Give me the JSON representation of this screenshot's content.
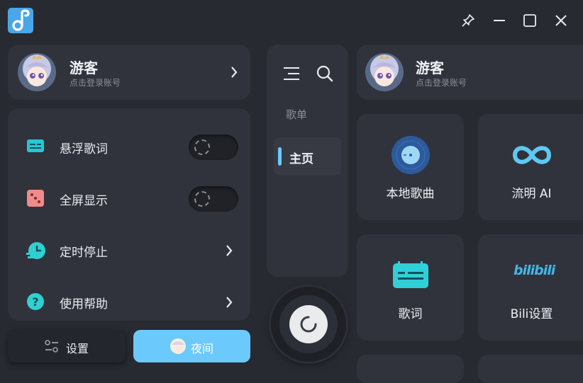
{
  "user": {
    "name": "游客",
    "subtitle": "点击登录账号"
  },
  "menu": [
    {
      "label": "悬浮歌词",
      "icon": "lyrics-float-icon",
      "control": "toggle"
    },
    {
      "label": "全屏显示",
      "icon": "fullscreen-dice-icon",
      "control": "toggle"
    },
    {
      "label": "定时停止",
      "icon": "timer-stop-icon",
      "control": "chevron"
    },
    {
      "label": "使用帮助",
      "icon": "help-icon",
      "control": "chevron"
    }
  ],
  "bottom": {
    "settings_label": "设置",
    "night_label": "夜间"
  },
  "nav": {
    "playlist_label": "歌单",
    "home_label": "主页"
  },
  "tiles": [
    {
      "label": "本地歌曲",
      "icon": "local-songs-disc-icon"
    },
    {
      "label": "流明 AI",
      "icon": "infinity-ai-icon"
    },
    {
      "label": "歌词",
      "icon": "lyrics-tv-icon"
    },
    {
      "label": "Bili设置",
      "icon": "bilibili-logo-icon",
      "logo_text": "bilibili"
    }
  ],
  "colors": {
    "background": "#272a31",
    "panel": "#30333b",
    "accent": "#6cc9fb",
    "teal": "#2fd0cf"
  }
}
